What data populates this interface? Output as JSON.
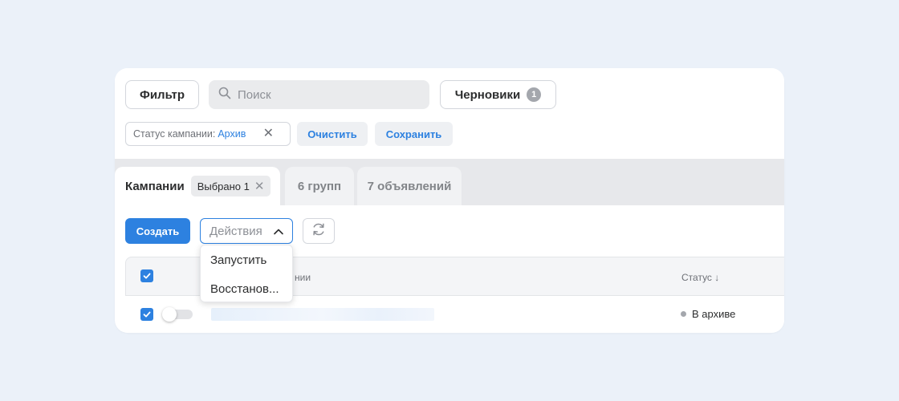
{
  "toolbar": {
    "filter_label": "Фильтр",
    "search_placeholder": "Поиск",
    "drafts_label": "Черновики",
    "drafts_count": "1"
  },
  "filter_chip": {
    "label": "Статус кампании:",
    "value": "Архив"
  },
  "filter_actions": {
    "clear_label": "Очистить",
    "save_label": "Сохранить"
  },
  "tabs": [
    {
      "label": "Кампании",
      "selected_label": "Выбрано 1"
    },
    {
      "label": "6 групп"
    },
    {
      "label": "7 объявлений"
    }
  ],
  "controls": {
    "create_label": "Создать",
    "actions_placeholder": "Действия"
  },
  "actions_menu": [
    "Запустить",
    "Восстанов..."
  ],
  "table": {
    "col_name_partial": "нии",
    "col_status": "Статус ↓",
    "rows": [
      {
        "status": "В архиве"
      }
    ]
  },
  "colors": {
    "accent": "#2d81e0",
    "background": "#ebf1f9"
  }
}
